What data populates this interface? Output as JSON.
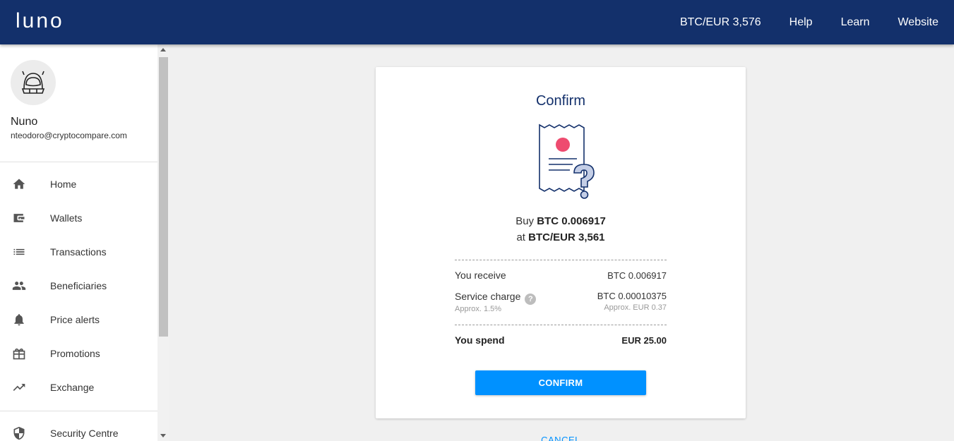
{
  "brand": {
    "logo_text": "luno",
    "header_color": "#13306b",
    "accent": "#0091ff"
  },
  "topnav": {
    "ticker": "BTC/EUR 3,576",
    "help": "Help",
    "learn": "Learn",
    "website": "Website"
  },
  "user": {
    "name": "Nuno",
    "email": "nteodoro@cryptocompare.com",
    "avatar_icon": "astronaut-helmet-icon"
  },
  "sidebar": {
    "items": [
      {
        "label": "Home",
        "icon": "home-icon"
      },
      {
        "label": "Wallets",
        "icon": "wallet-icon"
      },
      {
        "label": "Transactions",
        "icon": "list-icon"
      },
      {
        "label": "Beneficiaries",
        "icon": "people-icon"
      },
      {
        "label": "Price alerts",
        "icon": "bell-icon"
      },
      {
        "label": "Promotions",
        "icon": "gift-icon"
      },
      {
        "label": "Exchange",
        "icon": "trending-up-icon"
      },
      {
        "label": "Security Centre",
        "icon": "shield-icon"
      }
    ]
  },
  "confirm": {
    "title": "Confirm",
    "illustration": "receipt-question-icon",
    "buy_prefix": "Buy",
    "buy_amount": "BTC 0.006917",
    "at_prefix": "at",
    "rate": "BTC/EUR 3,561",
    "receive_label": "You receive",
    "receive_value": "BTC 0.006917",
    "charge_label": "Service charge",
    "charge_sub": "Approx. 1.5%",
    "charge_value": "BTC 0.00010375",
    "charge_value_sub": "Approx. EUR 0.37",
    "spend_label": "You spend",
    "spend_value": "EUR 25.00",
    "confirm_button": "CONFIRM",
    "cancel_link": "CANCEL"
  }
}
